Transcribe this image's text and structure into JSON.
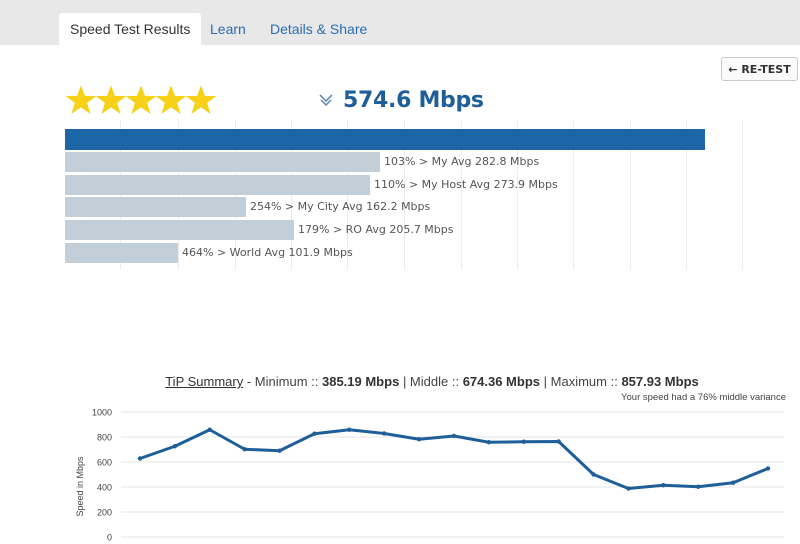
{
  "tabs": [
    {
      "label": "Speed Test Results",
      "active": true
    },
    {
      "label": "Learn",
      "active": false
    },
    {
      "label": "Details & Share",
      "active": false
    }
  ],
  "retest_label": "← RE-TEST",
  "rating": {
    "stars": 5,
    "max": 5,
    "star_color": "#f7d117"
  },
  "speed": {
    "value": "574.6 Mbps",
    "icon": "download-arrow-icon"
  },
  "comparison": {
    "max_value": 660,
    "main": {
      "value": 574.6,
      "color": "#1c66a8"
    },
    "rows": [
      {
        "label": "103% > My Avg 282.8 Mbps",
        "value": 282.8
      },
      {
        "label": "110% > My Host Avg 273.9 Mbps",
        "value": 273.9
      },
      {
        "label": "254% > My City Avg 162.2 Mbps",
        "value": 162.2
      },
      {
        "label": "179% > RO Avg 205.7 Mbps",
        "value": 205.7
      },
      {
        "label": "464% > World Avg 101.9 Mbps",
        "value": 101.9
      }
    ]
  },
  "summary": {
    "link": "TiP Summary",
    "prefix": "- Minimum ::",
    "minimum": "385.19 Mbps",
    "middle_label": "| Middle ::",
    "middle": "674.36 Mbps",
    "maximum_label": "| Maximum ::",
    "maximum": "857.93 Mbps",
    "variance_note": "Your speed had a 76% middle variance"
  },
  "chart_data": {
    "type": "line",
    "ylabel": "Speed in Mbps",
    "ylim": [
      0,
      1000
    ],
    "yticks": [
      "1000",
      "800",
      "600",
      "400",
      "200",
      "0"
    ],
    "grid": true,
    "line_color": "#1f5f99",
    "series": [
      {
        "values": [
          628,
          726,
          858,
          702,
          690,
          826,
          858,
          828,
          782,
          808,
          758,
          762,
          764,
          500,
          388,
          414,
          402,
          434,
          548
        ]
      }
    ]
  }
}
